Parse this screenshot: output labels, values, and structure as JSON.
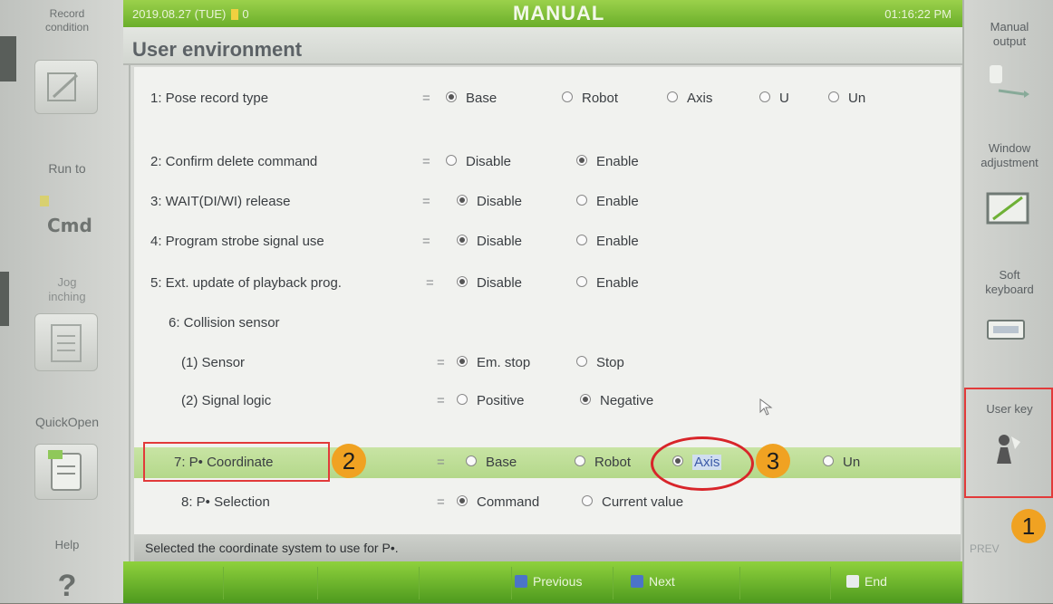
{
  "header": {
    "date": "2019.08.27 (TUE)",
    "signal": "0",
    "mode": "MANUAL",
    "time": "01:16:22 PM"
  },
  "page_title": "User environment",
  "left_panel": {
    "items": [
      {
        "label": "Record\ncondition"
      },
      {
        "label": "Run to"
      },
      {
        "label": "Jog\ninching"
      },
      {
        "label": "QuickOpen"
      },
      {
        "label": "Help"
      }
    ],
    "cmd_icon_text": "Cmd",
    "help_icon": "question-mark-icon"
  },
  "settings": [
    {
      "label": "1: Pose record type",
      "options": [
        "Base",
        "Robot",
        "Axis",
        "U",
        "Un"
      ],
      "selected": 0
    },
    {
      "label": "2: Confirm delete command",
      "options": [
        "Disable",
        "Enable"
      ],
      "selected": 1
    },
    {
      "label": "3: WAIT(DI/WI) release",
      "options": [
        "Disable",
        "Enable"
      ],
      "selected": 0
    },
    {
      "label": "4: Program strobe signal use",
      "options": [
        "Disable",
        "Enable"
      ],
      "selected": 0
    },
    {
      "label": "5: Ext. update of playback prog.",
      "options": [
        "Disable",
        "Enable"
      ],
      "selected": 0
    },
    {
      "label": "6: Collision sensor"
    },
    {
      "label": "(1) Sensor",
      "options": [
        "Em. stop",
        "Stop"
      ],
      "selected": 0
    },
    {
      "label": "(2) Signal logic",
      "options": [
        "Positive",
        "Negative"
      ],
      "selected": 1
    },
    {
      "label": "7: P• Coordinate",
      "options": [
        "Base",
        "Robot",
        "Axis",
        "Un"
      ],
      "selected": 2
    },
    {
      "label": "8: P• Selection",
      "options": [
        "Command",
        "Current value"
      ],
      "selected": 0
    }
  ],
  "equals": "=",
  "status_message": "Selected the coordinate system to use for P•.",
  "bottom_bar": {
    "previous": "Previous",
    "next": "Next",
    "end": "End"
  },
  "right_panel": {
    "manual_output": "Manual\noutput",
    "window_adjustment": "Window\nadjustment",
    "soft_keyboard": "Soft\nkeyboard",
    "user_key": "User key",
    "prev": "PREV"
  },
  "annotations": {
    "one": "1",
    "two": "2",
    "three": "3"
  },
  "colors": {
    "header_green": "#7cc235",
    "highlight_row": "#bcdc95",
    "annotation_red": "#e23a3a",
    "annotation_badge": "#f0a222"
  }
}
